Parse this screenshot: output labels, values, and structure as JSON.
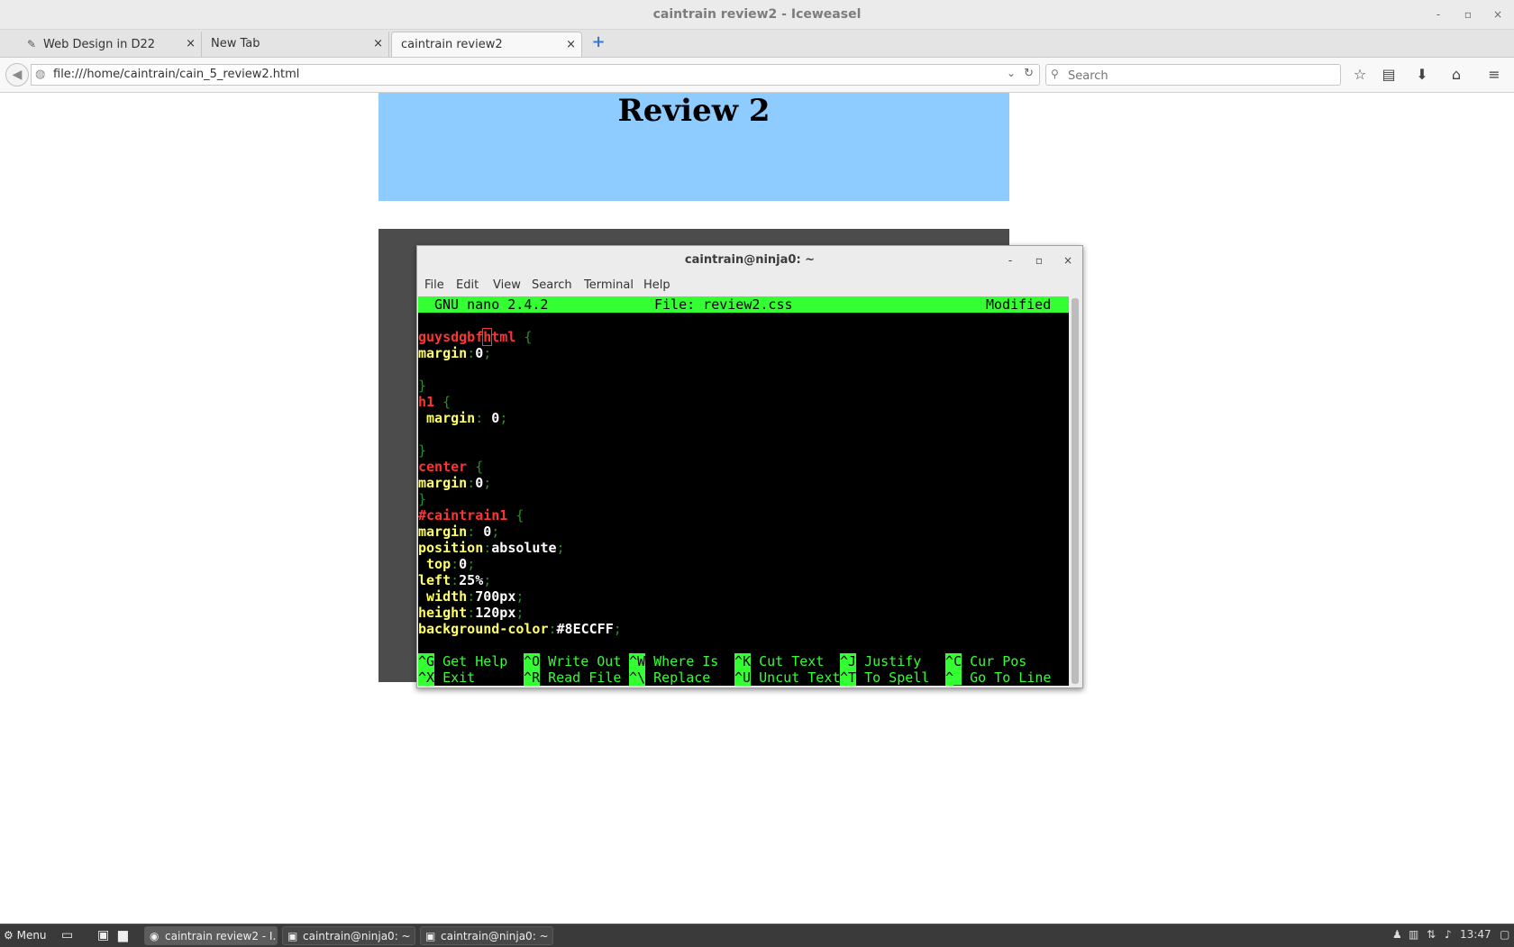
{
  "window": {
    "title": "caintrain review2 - Iceweasel",
    "minimize": "-",
    "maximize": "▫",
    "close": "×"
  },
  "tabs": [
    {
      "label": "Web Design in D22",
      "close": "×"
    },
    {
      "label": "New Tab",
      "close": "×"
    },
    {
      "label": "caintrain review2",
      "close": "×"
    }
  ],
  "newtab_label": "+",
  "nav": {
    "url": "file:///home/caintrain/cain_5_review2.html",
    "search_placeholder": "Search"
  },
  "page": {
    "heading": "Review 2",
    "header_color": "#8ECCFF"
  },
  "terminal": {
    "title": "caintrain@ninja0: ~",
    "menu": [
      "File",
      "Edit",
      "View",
      "Search",
      "Terminal",
      "Help"
    ],
    "nano": {
      "version": "GNU nano 2.4.2",
      "file": "File: review2.css",
      "status": "Modified"
    },
    "code": {
      "l1_a": "guysdgbf",
      "l1_cur": "h",
      "l1_b": "tml",
      "brace_open": "{",
      "brace_close": "}",
      "colon": ":",
      "semi": ";",
      "margin": "margin",
      "zero": "0",
      "h1": "h1",
      "center": "center",
      "caintrain1": "#caintrain1",
      "position": "position",
      "absolute": "absolute",
      "top": "top",
      "left": "left",
      "left_val": "25%",
      "width": "width",
      "width_val": "700px",
      "height": "height",
      "height_val": "120px",
      "bgcolor": "background-color",
      "bgcolor_val": "#8ECCFF"
    },
    "shortcuts": [
      {
        "key": "^G",
        "label": "Get Help"
      },
      {
        "key": "^O",
        "label": "Write Out"
      },
      {
        "key": "^W",
        "label": "Where Is"
      },
      {
        "key": "^K",
        "label": "Cut Text"
      },
      {
        "key": "^J",
        "label": "Justify"
      },
      {
        "key": "^C",
        "label": "Cur Pos"
      },
      {
        "key": "^X",
        "label": "Exit"
      },
      {
        "key": "^R",
        "label": "Read File"
      },
      {
        "key": "^\\",
        "label": "Replace"
      },
      {
        "key": "^U",
        "label": "Uncut Text"
      },
      {
        "key": "^T",
        "label": "To Spell"
      },
      {
        "key": "^_",
        "label": "Go To Line"
      }
    ]
  },
  "taskbar": {
    "menu": "Menu",
    "tasks": [
      {
        "label": "caintrain review2 - I..."
      },
      {
        "label": "caintrain@ninja0: ~"
      },
      {
        "label": "caintrain@ninja0: ~"
      }
    ],
    "clock": "13:47"
  }
}
